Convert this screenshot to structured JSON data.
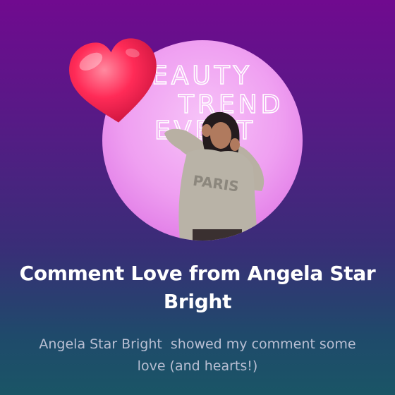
{
  "notification": {
    "title": "Comment Love from Angela Star Bright",
    "message": "Angela Star Bright  showed my comment some love (and hearts!)",
    "reaction_icon": "heart-icon",
    "avatar_backdrop_text": [
      "EAUTY",
      "TREND",
      "EVENT"
    ],
    "avatar_shirt_text": "PARIS"
  },
  "colors": {
    "background_top": "#700a8f",
    "background_bottom": "#1a5566",
    "avatar_bg": "#f3a6f4",
    "heart": "#ff2b57",
    "title_text": "#ffffff",
    "message_text": "#b9bfd3"
  }
}
